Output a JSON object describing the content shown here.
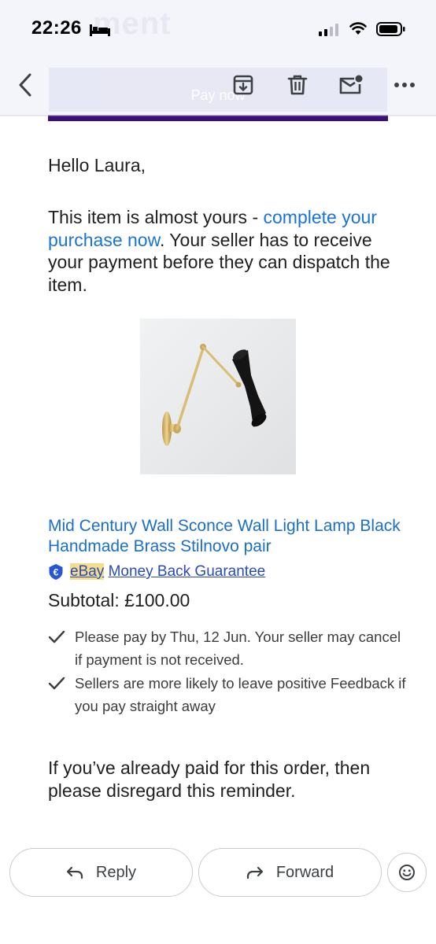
{
  "status_bar": {
    "time": "22:26",
    "ghost_text": "ment"
  },
  "app_bar": {
    "ghost_button": "Pay now",
    "icons": [
      "back-arrow-icon",
      "archive-icon",
      "delete-icon",
      "mark-unread-icon",
      "more-vert-icon"
    ]
  },
  "email": {
    "greeting": "Hello Laura,",
    "intro_before_link": "This item is almost yours - ",
    "intro_link": "complete your purchase now",
    "intro_after_link": ". Your seller has to receive your payment before they can dispatch the item.",
    "product_title": "Mid Century Wall Sconce Wall Light Lamp Black Handmade Brass Stilnovo pair",
    "guarantee_brand": "eBay",
    "guarantee_text": "Money Back Guarantee",
    "subtotal": "Subtotal: £100.00",
    "checklist": [
      "Please pay by Thu, 12 Jun. Your seller may cancel if payment is not received.",
      "Sellers are more likely to leave positive Feedback if you pay straight away"
    ],
    "disclaimer": "If you’ve already paid for this order, then please disregard this reminder."
  },
  "actions": {
    "reply_label": "Reply",
    "forward_label": "Forward"
  },
  "colors": {
    "accent_link": "#1a73d8",
    "purple_strip": "#3a1075",
    "guarantee_highlight": "#f5dc8e"
  }
}
